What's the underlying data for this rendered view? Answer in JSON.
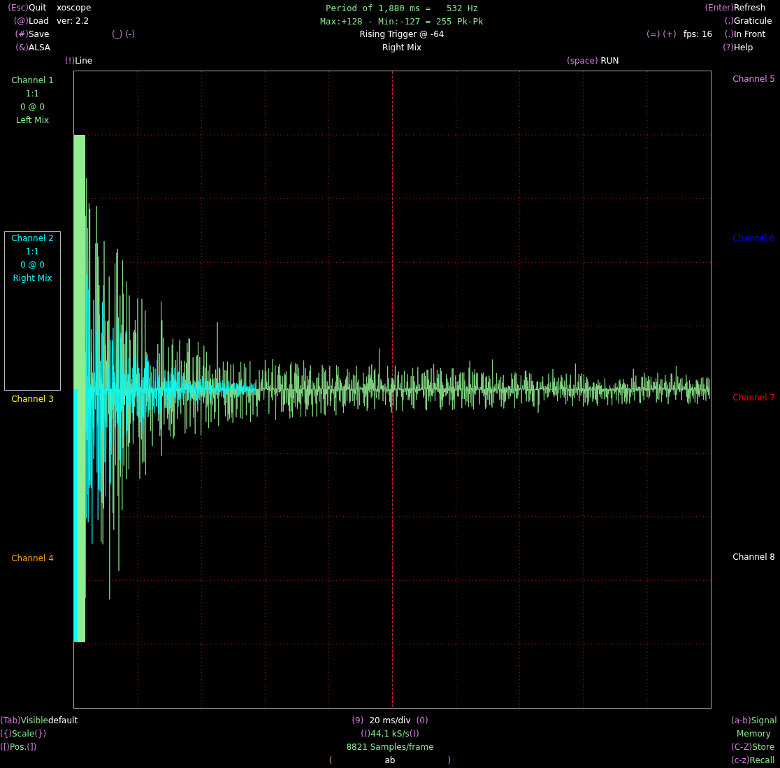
{
  "header": {
    "menu_left": [
      {
        "key": "(Esc)",
        "label": "Quit"
      },
      {
        "key": "(@)",
        "label": "Load"
      },
      {
        "key": "(#)",
        "label": "Save"
      },
      {
        "key": "(&)",
        "label": "ALSA"
      }
    ],
    "title": "xoscope",
    "version": "ver: 2.2",
    "line_mode": {
      "key": "(!)",
      "label": "Line"
    },
    "trigger_position_keys": "(_) (-)",
    "measurements": [
      "Period of 1,880 ms =   532 Hz",
      "Max:+128 - Min:-127 = 255 Pk-Pk"
    ],
    "trigger": "Rising Trigger @ -64",
    "trigger_source": "Right Mix",
    "trigger_level_keys": "(=) (+)",
    "fps": "fps: 16",
    "run": {
      "key": "(space)",
      "label": "RUN"
    },
    "menu_right": [
      {
        "key": "(Enter)",
        "label": "Refresh"
      },
      {
        "key": "(,)",
        "label": "Graticule"
      },
      {
        "key": "(.)",
        "label": "In Front"
      },
      {
        "key": "(?)",
        "label": "Help"
      }
    ]
  },
  "channels": [
    {
      "name": "Channel 1",
      "lines": [
        "1:1",
        "0 @ 0",
        "Left Mix"
      ],
      "color": "#90ee90",
      "selected": false
    },
    {
      "name": "Channel 2",
      "lines": [
        "1:1",
        "0 @ 0",
        "Right Mix"
      ],
      "color": "#00ffff",
      "selected": true
    },
    {
      "name": "Channel 3",
      "color": "#ffff00",
      "selected": false
    },
    {
      "name": "Channel 4",
      "color": "#ffa500",
      "selected": false
    },
    {
      "name": "Channel 5",
      "color": "#ee82ee",
      "selected": false
    },
    {
      "name": "Channel 6",
      "color": "#0000ff",
      "selected": false
    },
    {
      "name": "Channel 7",
      "color": "#ff0000",
      "selected": false
    },
    {
      "name": "Channel 8",
      "color": "#ffffff",
      "selected": false
    }
  ],
  "footer": {
    "left": [
      [
        {
          "text": "(Tab)",
          "kind": "key"
        },
        {
          "text": "Visible",
          "kind": "label"
        },
        {
          "text": "default",
          "kind": "value"
        }
      ],
      [
        {
          "text": "({)",
          "kind": "key"
        },
        {
          "text": "Scale",
          "kind": "label"
        },
        {
          "text": "(})",
          "kind": "key"
        }
      ],
      [
        {
          "text": "([)",
          "kind": "key"
        },
        {
          "text": "Pos.",
          "kind": "label"
        },
        {
          "text": "(])",
          "kind": "key"
        }
      ]
    ],
    "center": [
      [
        {
          "text": "(9)",
          "kind": "key"
        },
        {
          "text": "20 ms/div",
          "kind": "value"
        },
        {
          "text": "(0)",
          "kind": "key"
        }
      ],
      [
        {
          "text": "(()",
          "kind": "key"
        },
        {
          "text": "44,1 kS/s",
          "kind": "label"
        },
        {
          "text": "())",
          "kind": "key"
        }
      ],
      [
        {
          "text": "8821 Samples/frame",
          "kind": "label"
        }
      ],
      [
        {
          "text": "(",
          "kind": "key"
        },
        {
          "text": "ab",
          "kind": "value"
        },
        {
          "text": ")",
          "kind": "key"
        }
      ]
    ],
    "right": [
      [
        {
          "text": "(a-b)",
          "kind": "key"
        },
        {
          "text": "Signal",
          "kind": "label"
        }
      ],
      [
        {
          "text": "Memory",
          "kind": "label"
        }
      ],
      [
        {
          "text": "(C-Z)",
          "kind": "key"
        },
        {
          "text": "Store",
          "kind": "label"
        }
      ],
      [
        {
          "text": "(c-z)",
          "kind": "key"
        },
        {
          "text": "Recall",
          "kind": "label"
        }
      ]
    ]
  }
}
